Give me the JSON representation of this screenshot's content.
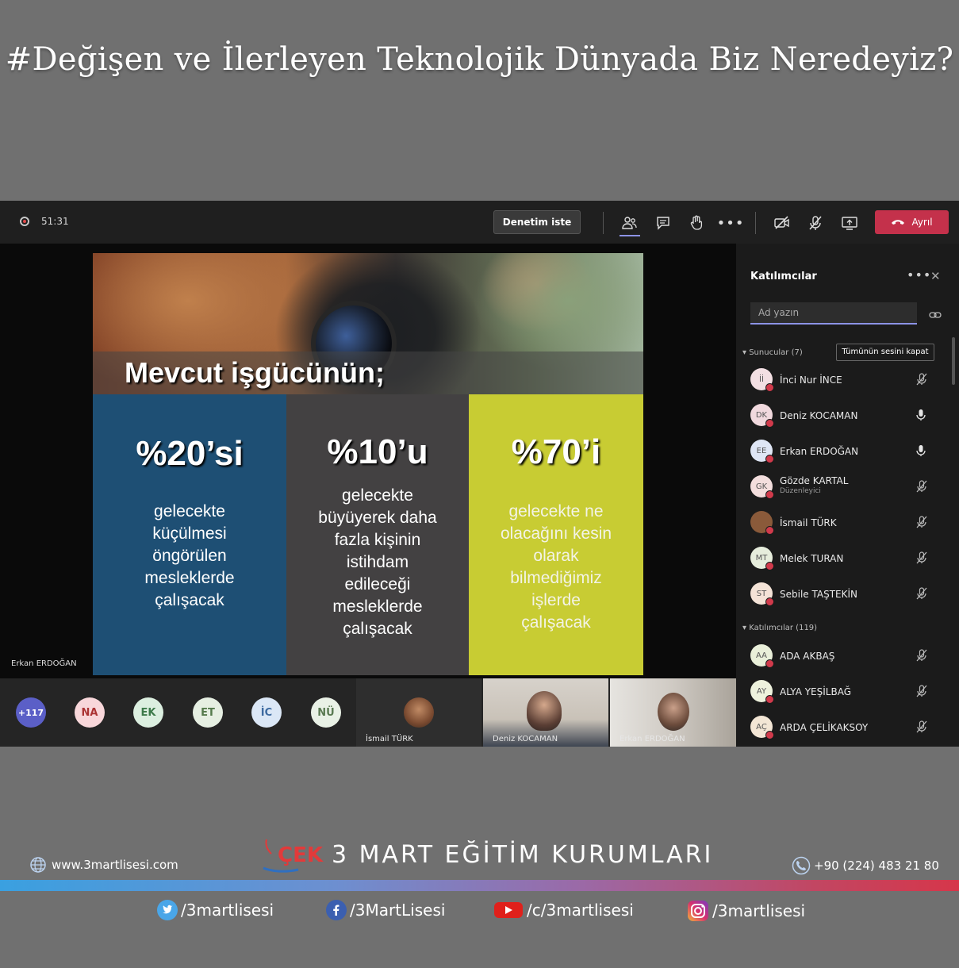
{
  "headline": "#Değişen ve İlerleyen Teknolojik Dünyada Biz Neredeyiz?",
  "meeting": {
    "timer": "51:31",
    "request_control": "Denetim iste",
    "leave": "Ayrıl",
    "stage_name": "Erkan ERDOĞAN"
  },
  "slide": {
    "title": "Mevcut işgücünün;",
    "columns": [
      {
        "pct": "%20’si",
        "lines": [
          "gelecekte",
          "küçülmesi",
          "öngörülen",
          "mesleklerde",
          "çalışacak"
        ]
      },
      {
        "pct": "%10’u",
        "lines": [
          "gelecekte",
          "büyüyerek daha",
          "fazla kişinin",
          "istihdam",
          "edileceği",
          "mesleklerde",
          "çalışacak"
        ]
      },
      {
        "pct": "%70’i",
        "lines": [
          "gelecekte ne",
          "olacağını kesin",
          "olarak",
          "bilmediğimiz",
          "işlerde",
          "çalışacak"
        ]
      }
    ]
  },
  "strip": {
    "more_count": "+117",
    "avatars": [
      "NA",
      "EK",
      "ET",
      "İC",
      "NÜ"
    ],
    "tiles": [
      "İsmail TÜRK",
      "Deniz KOCAMAN",
      "Erkan ERDOĞAN"
    ]
  },
  "panel": {
    "title": "Katılımcılar",
    "search_placeholder": "Ad yazın",
    "presenters_header": "Sunucular (7)",
    "mute_all": "Tümünün sesini kapat",
    "attendees_header": "Katılımcılar (119)",
    "presenters": [
      {
        "initials": "İİ",
        "name": "İnci Nur İNCE",
        "sub": "",
        "mic": "muted"
      },
      {
        "initials": "DK",
        "name": "Deniz KOCAMAN",
        "sub": "",
        "mic": "on"
      },
      {
        "initials": "EE",
        "name": "Erkan ERDOĞAN",
        "sub": "",
        "mic": "on"
      },
      {
        "initials": "GK",
        "name": "Gözde KARTAL",
        "sub": "Düzenleyici",
        "mic": "muted"
      },
      {
        "initials": "",
        "name": "İsmail TÜRK",
        "sub": "",
        "mic": "muted"
      },
      {
        "initials": "MT",
        "name": "Melek TURAN",
        "sub": "",
        "mic": "muted"
      },
      {
        "initials": "ST",
        "name": "Sebile TAŞTEKİN",
        "sub": "",
        "mic": "muted"
      }
    ],
    "attendees": [
      {
        "initials": "AA",
        "name": "ADA AKBAŞ",
        "mic": "muted"
      },
      {
        "initials": "AY",
        "name": "ALYA YEŞİLBAĞ",
        "mic": "muted"
      },
      {
        "initials": "AÇ",
        "name": "ARDA ÇELİKAKSOY",
        "mic": "muted"
      }
    ]
  },
  "footer": {
    "website": "www.3martlisesi.com",
    "logo_text": "ÇEK",
    "brand": "3 MART EĞİTİM KURUMLARI",
    "phone": "+90 (224) 483 21 80",
    "twitter": "/3martlisesi",
    "facebook": "/3MartLisesi",
    "youtube": "/c/3martlisesi",
    "instagram": "/3martlisesi"
  },
  "colors": {
    "leave_button": "#c4314b",
    "accent": "#8c93e6",
    "col_blue": "#1e4f74",
    "col_gray": "#434142",
    "col_yellow": "#c8cc33"
  }
}
